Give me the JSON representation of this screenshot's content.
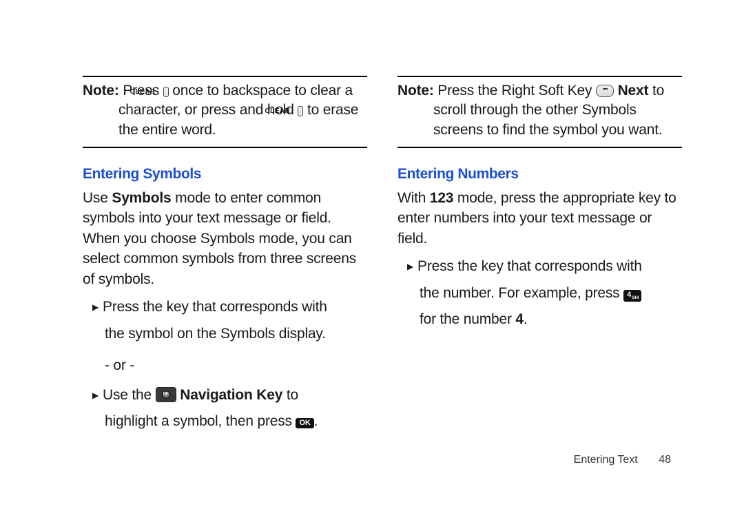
{
  "left": {
    "note": {
      "label": "Note:",
      "line1_a": "Press ",
      "clear1": "CLEAR",
      "line1_b": " once to backspace to clear a character, or press and hold ",
      "clear2": "CLEAR",
      "line1_c": " to erase the entire word."
    },
    "heading": "Entering Symbols",
    "para_a": "Use ",
    "para_b_bold": "Symbols",
    "para_c": " mode to enter common symbols into your text message or field. When you choose Symbols mode, you can select common symbols from three screens of symbols.",
    "bullet1_a": "Press the key that corresponds with",
    "bullet1_b": "the symbol on the Symbols display.",
    "or": "- or -",
    "bullet2_a": "Use the ",
    "bullet2_nav_bold": "Navigation Key",
    "bullet2_b": " to",
    "bullet2_c": "highlight a symbol, then press ",
    "ok": "OK",
    "bullet2_d": "."
  },
  "right": {
    "note": {
      "label": "Note:",
      "line1_a": "Press the Right Soft Key ",
      "next_bold": "Next",
      "line1_b": " to scroll through the other Symbols screens to find the symbol you want."
    },
    "heading": "Entering Numbers",
    "para_a": "With ",
    "para_b_bold": "123",
    "para_c": " mode, press the appropriate key to enter numbers into your text message or field.",
    "bullet1_a": "Press the key that corresponds with",
    "bullet1_b": "the number. For example, press ",
    "key4_main": "4",
    "key4_sub": "GHI",
    "bullet1_c": "for the number ",
    "bullet1_d_bold": "4",
    "bullet1_e": "."
  },
  "footer": {
    "section": "Entering Text",
    "page": "48"
  }
}
